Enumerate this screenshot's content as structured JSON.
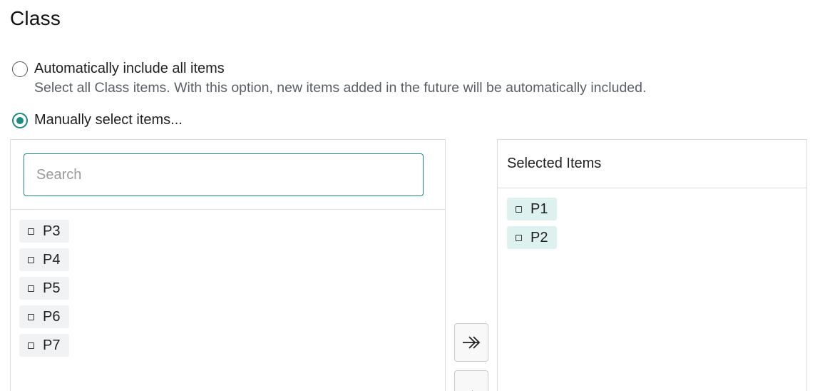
{
  "page": {
    "title": "Class"
  },
  "options": {
    "auto": {
      "label": "Automatically include all items",
      "description": "Select all Class items. With this option, new items added in the future will be automatically included.",
      "checked": false
    },
    "manual": {
      "label": "Manually select items...",
      "checked": true
    }
  },
  "available": {
    "search_placeholder": "Search",
    "search_value": "",
    "items": [
      {
        "label": "P3",
        "icon": "square-icon"
      },
      {
        "label": "P4",
        "icon": "square-icon"
      },
      {
        "label": "P5",
        "icon": "square-icon"
      },
      {
        "label": "P6",
        "icon": "square-icon"
      },
      {
        "label": "P7",
        "icon": "square-icon"
      }
    ]
  },
  "selected": {
    "header": "Selected Items",
    "items": [
      {
        "label": "P1",
        "icon": "square-icon"
      },
      {
        "label": "P2",
        "icon": "square-icon"
      }
    ]
  },
  "colors": {
    "accent": "#1a8c80",
    "chip_bg": "#f1f2f3",
    "selected_chip_bg": "#ddf1ee",
    "border": "#dcdcdc"
  }
}
